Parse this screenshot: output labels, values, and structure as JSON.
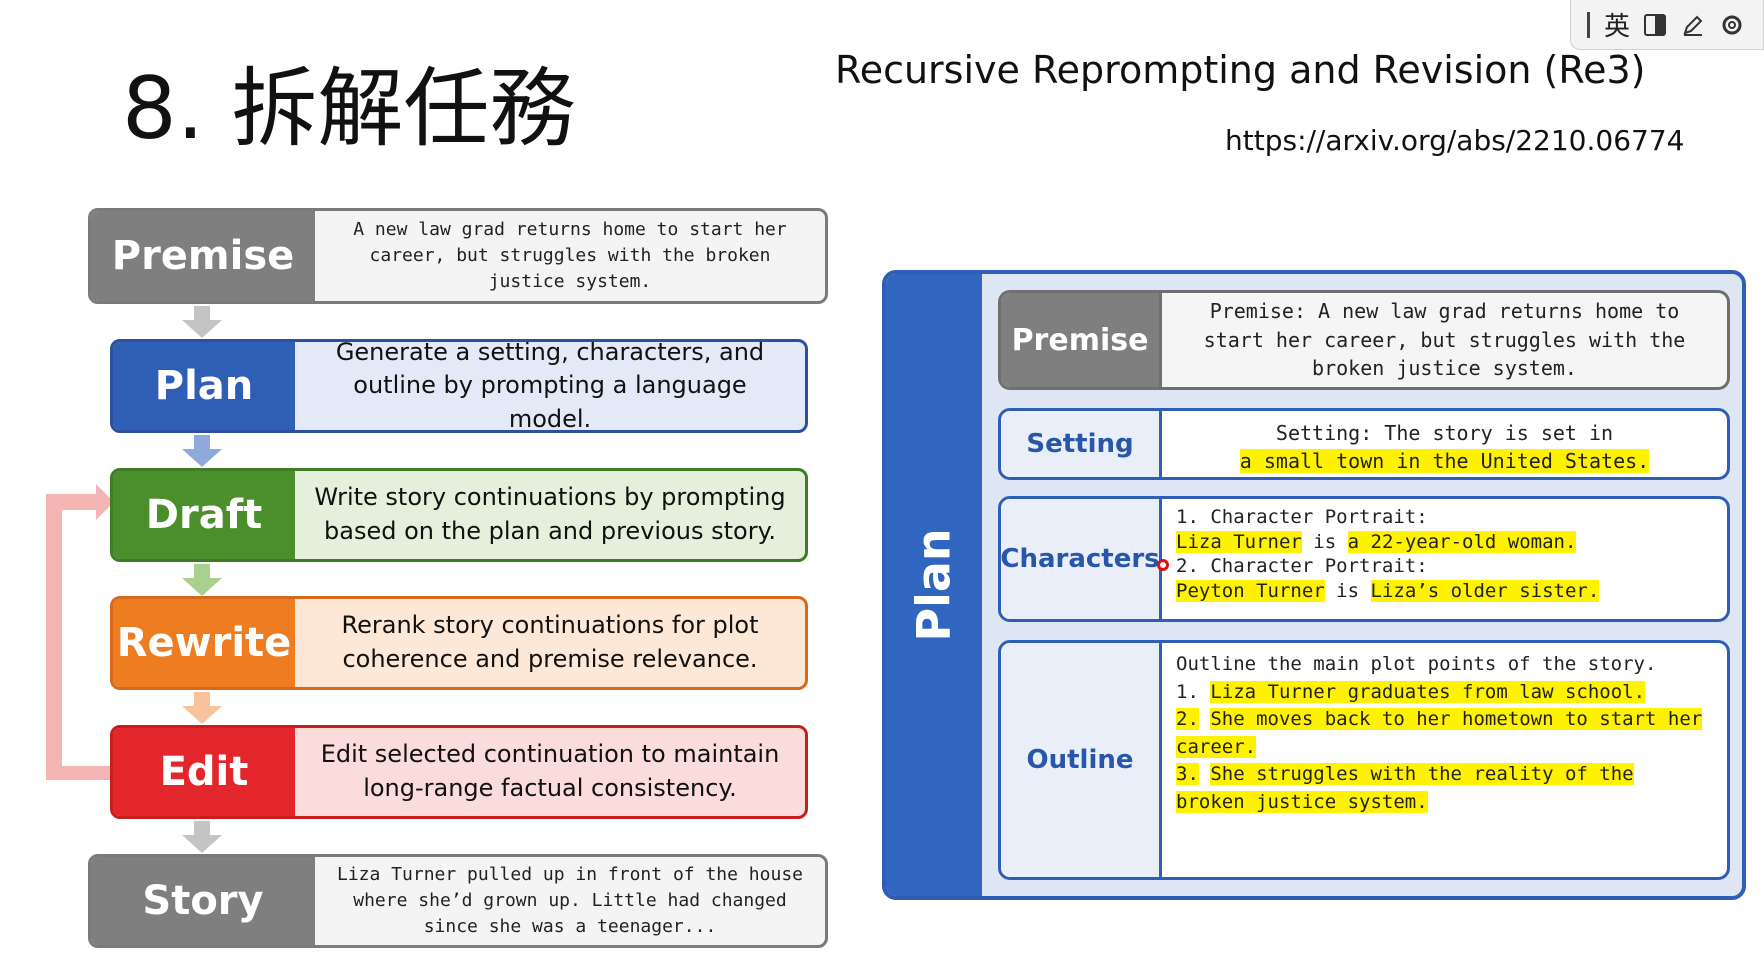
{
  "header": {
    "slide_title": "8. 拆解任務",
    "paper_title": "Recursive Reprompting and Revision (Re3)",
    "paper_url": "https://arxiv.org/abs/2210.06774"
  },
  "ime_toolbar": {
    "language": "英"
  },
  "pipeline": [
    {
      "label": "Premise",
      "text": "A new law grad returns home to start her career, but struggles with the broken justice system.",
      "color": "#7f7f7f"
    },
    {
      "label": "Plan",
      "text": "Generate a setting, characters, and outline by prompting a language model.",
      "color": "#2f5fb5"
    },
    {
      "label": "Draft",
      "text": "Write story continuations by prompting based on the plan and previous story.",
      "color": "#4b8f2c"
    },
    {
      "label": "Rewrite",
      "text": "Rerank story continuations for plot coherence and premise relevance.",
      "color": "#ee7d22"
    },
    {
      "label": "Edit",
      "text": "Edit selected continuation to maintain long-range factual consistency.",
      "color": "#e3262c"
    },
    {
      "label": "Story",
      "text": "Liza Turner pulled up in front of the house where she’d grown up. Little had changed since she was a teenager...",
      "color": "#7f7f7f"
    }
  ],
  "plan_panel": {
    "label": "Plan",
    "premise": {
      "label": "Premise",
      "text": "Premise: A new law grad returns home to start her career, but struggles with the broken justice system."
    },
    "setting": {
      "label": "Setting",
      "prefix": "Setting: The story is set in",
      "highlight": "a small town in the United States."
    },
    "characters": {
      "label": "Characters",
      "items": [
        {
          "heading": "1. Character Portrait:",
          "name": "Liza Turner",
          "is": "is",
          "desc": "a 22-year-old woman."
        },
        {
          "heading": "2. Character Portrait:",
          "name": "Peyton Turner",
          "is": "is",
          "desc": "Liza’s older sister."
        }
      ]
    },
    "outline": {
      "label": "Outline",
      "intro": "Outline the main plot points of the story.",
      "points": [
        {
          "num": "1.",
          "text": "Liza Turner graduates from law school."
        },
        {
          "num": "2.",
          "text": "She moves back to her hometown to start her career."
        },
        {
          "num": "3.",
          "text": "She struggles with the reality of the broken justice system."
        }
      ]
    }
  }
}
